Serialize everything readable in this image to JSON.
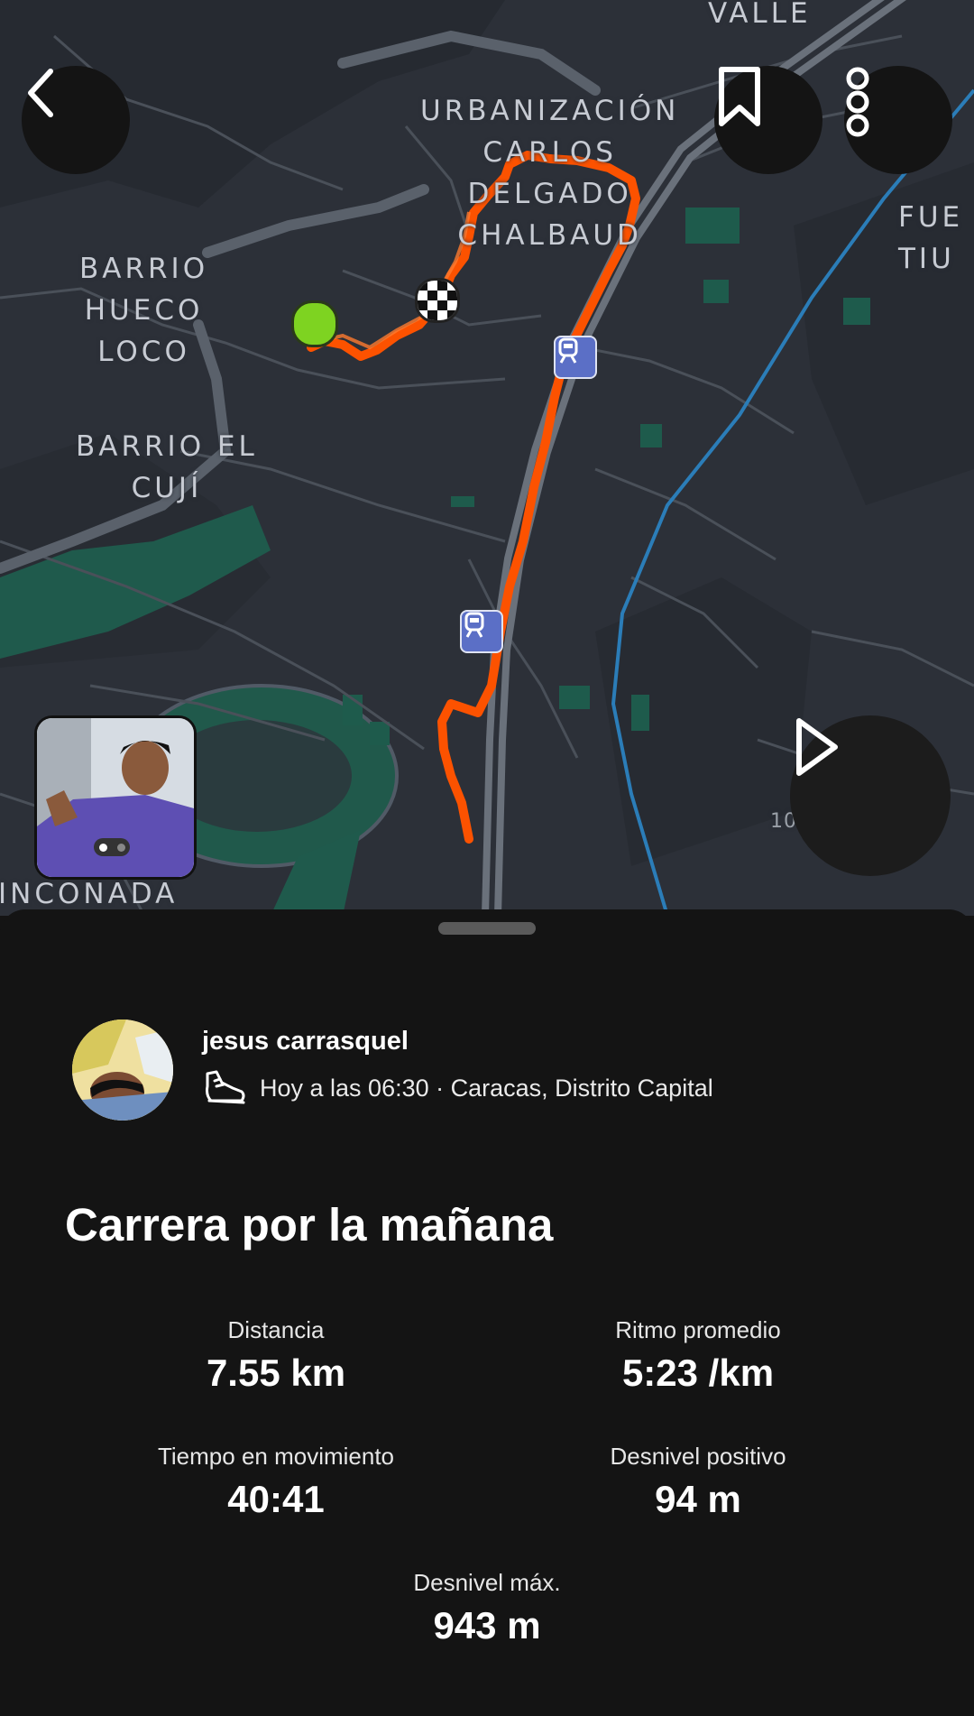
{
  "map": {
    "labels": {
      "valle": "VALLE",
      "urbanizacion": "URBANIZACIÓN\nCARLOS\nDELGADO\nCHALBAUD",
      "barrio_hueco": "BARRIO\nHUECO\nLOCO",
      "barrio_cuji": "BARRIO EL\nCUJÍ",
      "fuerte": "FUE\nTIU",
      "rinconada": "INCONADA",
      "road_number": "10"
    },
    "route_color": "#fc5200",
    "start_color": "#7ed321",
    "icons": {
      "back": "chevron-left-icon",
      "bookmark": "bookmark-icon",
      "more": "more-vertical-icon",
      "play": "play-icon",
      "transit": "train-icon",
      "finish": "checkered-flag-icon"
    }
  },
  "activity": {
    "username": "jesus carrasquel",
    "meta": "Hoy a las 06:30 · Caracas, Distrito Capital",
    "sport_icon": "running-shoe-icon",
    "title": "Carrera por la mañana"
  },
  "stats": [
    {
      "label": "Distancia",
      "value": "7.55 km"
    },
    {
      "label": "Ritmo promedio",
      "value": "5:23 /km"
    },
    {
      "label": "Tiempo en movimiento",
      "value": "40:41"
    },
    {
      "label": "Desnivel positivo",
      "value": "94 m"
    },
    {
      "label": "Desnivel máx.",
      "value": "943 m"
    }
  ]
}
